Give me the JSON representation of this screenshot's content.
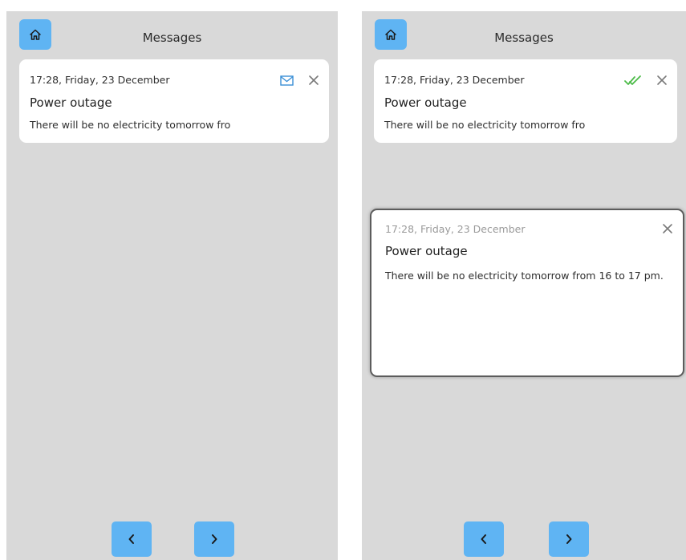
{
  "screens": [
    {
      "title": "Messages",
      "message": {
        "time": "17:28, Friday, 23 December",
        "subject": "Power outage",
        "preview": "There will be no electricity tomorrow fro",
        "status_icon": "envelope-icon"
      }
    },
    {
      "title": "Messages",
      "message": {
        "time": "17:28, Friday, 23 December",
        "subject": "Power outage",
        "preview": "There will be no electricity tomorrow fro",
        "status_icon": "read-check-icon"
      },
      "popup": {
        "time": "17:28, Friday, 23 December",
        "subject": "Power outage",
        "body": "There will be no electricity tomorrow from 16 to 17 pm."
      }
    }
  ],
  "colors": {
    "accent": "#5fb4f3",
    "screen_background": "#d9d9d9",
    "read_check": "#4cbb48",
    "envelope": "#3a8fd6"
  }
}
